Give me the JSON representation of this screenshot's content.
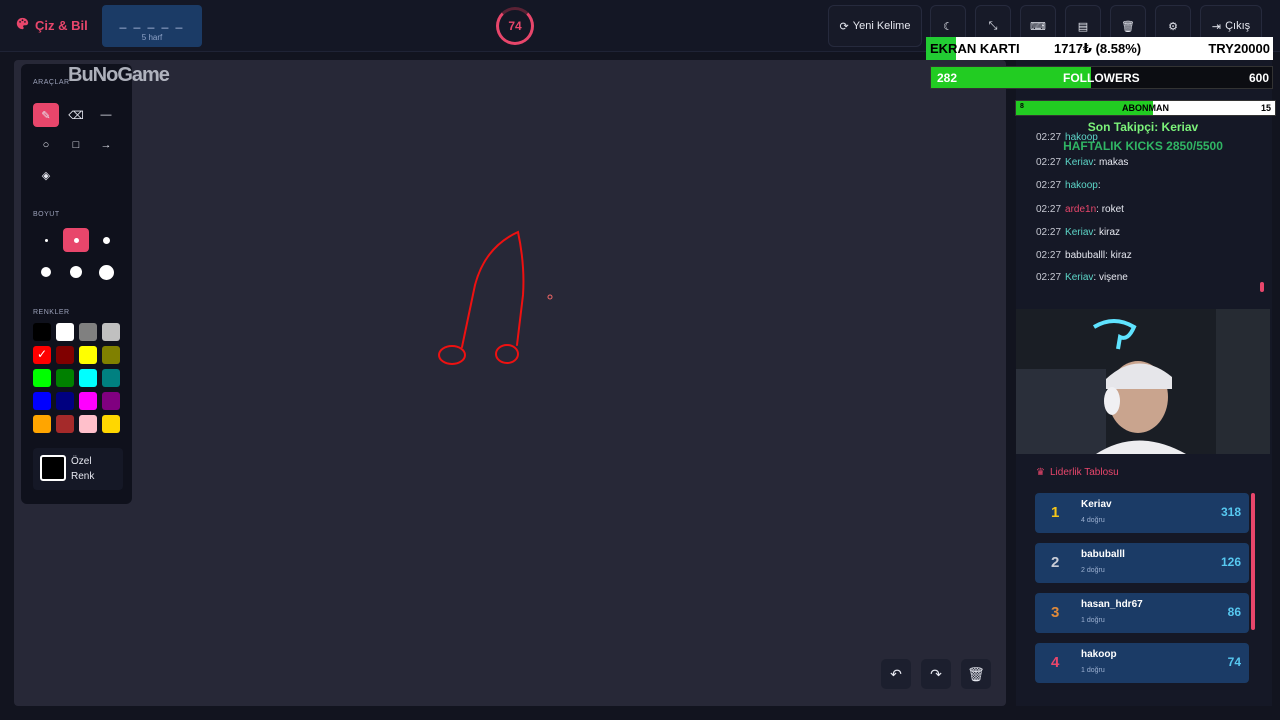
{
  "header": {
    "brand": "Çiz & Bil",
    "word_dashes": "_ _ _ _ _",
    "word_length": "5 harf",
    "timer": "74",
    "new_word_label": "Yeni Kelime",
    "exit_label": "Çıkış",
    "icons": [
      "moon-icon",
      "compress-icon",
      "keyboard-icon",
      "archive-icon",
      "trash-icon",
      "gear-icon",
      "sign-out-icon"
    ]
  },
  "tools": {
    "title": "ARAÇLAR",
    "size_title": "BOYUT",
    "colors_title": "RENKLER",
    "custom_color_label": "Özel Renk",
    "active_tool": "brush",
    "swatches": [
      "#000000",
      "#ffffff",
      "#808080",
      "#c0c0c0",
      "#ff0000",
      "#800000",
      "#ffff00",
      "#808000",
      "#00ff00",
      "#008000",
      "#00ffff",
      "#008080",
      "#0000ff",
      "#000080",
      "#ff00ff",
      "#800080",
      "#ffa500",
      "#a52a2a",
      "#ffc0cb",
      "#ffd700"
    ],
    "selected_color": "#ff0000"
  },
  "watermark": "BuNoGame",
  "overlays": {
    "gpu_label": "EKRAN KARTI",
    "gpu_value": "1717₺ (8.58%)",
    "gpu_goal": "TRY20000",
    "gpu_progress": 0.0858,
    "followers_count": "282",
    "followers_label": "FOLLOWERS",
    "followers_goal": "600",
    "followers_progress": 0.47,
    "sub_count": "8",
    "sub_label": "ABONMAN",
    "sub_goal": "15",
    "sub_progress": 0.53,
    "last_follower": "Son Takipçi: Keriav",
    "weekly_kicks": "HAFTALIK KICKS 2850/5500"
  },
  "chat": [
    {
      "time": "02:27",
      "user": "hakoop",
      "user_color": "#5dd6c8",
      "message": ""
    },
    {
      "time": "02:27",
      "user": "Keriav",
      "user_color": "#5dd6c8",
      "message": ": makas"
    },
    {
      "time": "02:27",
      "user": "hakoop",
      "user_color": "#5dd6c8",
      "message": ":"
    },
    {
      "time": "02:27",
      "user": "arde1n",
      "user_color": "#e8466b",
      "message": ": roket"
    },
    {
      "time": "02:27",
      "user": "Keriav",
      "user_color": "#5dd6c8",
      "message": ": kiraz"
    },
    {
      "time": "02:27",
      "user": "babuballl",
      "user_color": "#e6e8f0",
      "message": ": kiraz"
    },
    {
      "time": "02:27",
      "user": "Keriav",
      "user_color": "#5dd6c8",
      "message": ": vişene"
    }
  ],
  "leaderboard": {
    "title": "Liderlik Tablosu",
    "rows": [
      {
        "rank": "1",
        "name": "Keriav",
        "sub": "4 doğru",
        "score": "318",
        "rank_color": "#f5c518"
      },
      {
        "rank": "2",
        "name": "babuballl",
        "sub": "2 doğru",
        "score": "126",
        "rank_color": "#c9ccd6"
      },
      {
        "rank": "3",
        "name": "hasan_hdr67",
        "sub": "1 doğru",
        "score": "86",
        "rank_color": "#e08a3a"
      },
      {
        "rank": "4",
        "name": "hakoop",
        "sub": "1 doğru",
        "score": "74",
        "rank_color": "#e8466b"
      }
    ]
  }
}
